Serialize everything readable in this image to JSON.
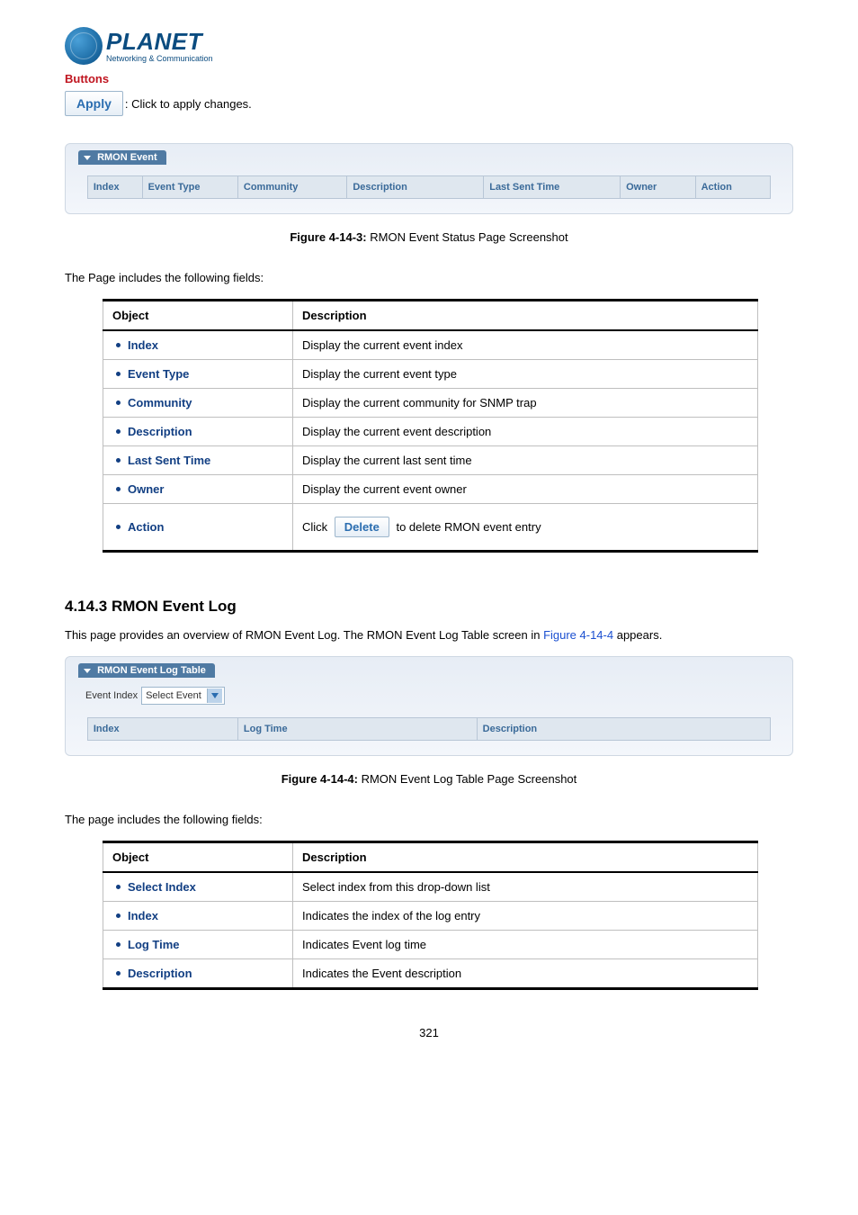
{
  "logo": {
    "main": "PLANET",
    "sub": "Networking & Communication"
  },
  "buttons_section": {
    "heading": "Buttons",
    "apply_label": "Apply",
    "apply_desc": ": Click to apply changes."
  },
  "panel1": {
    "legend": "RMON Event",
    "cols": [
      "Index",
      "Event Type",
      "Community",
      "Description",
      "Last Sent Time",
      "Owner",
      "Action"
    ]
  },
  "figure1": {
    "label": "Figure 4-14-3:",
    "caption": "RMON Event Status Page Screenshot"
  },
  "intro1": "The Page includes the following fields:",
  "objtable1": {
    "headers": {
      "object": "Object",
      "description": "Description"
    },
    "rows": [
      {
        "obj": "Index",
        "desc": "Display the current event index"
      },
      {
        "obj": "Event Type",
        "desc": "Display the current event type"
      },
      {
        "obj": "Community",
        "desc": "Display the current community for SNMP trap"
      },
      {
        "obj": "Description",
        "desc": "Display the current event description"
      },
      {
        "obj": "Last Sent Time",
        "desc": "Display the current last sent time"
      },
      {
        "obj": "Owner",
        "desc": "Display the current event owner"
      }
    ],
    "action_row": {
      "obj": "Action",
      "pre": "Click",
      "button": "Delete",
      "post": "to delete RMON event entry"
    }
  },
  "section2": {
    "heading": "4.14.3 RMON Event Log",
    "intro_pre": "This page provides an overview of RMON Event Log. The RMON Event Log Table screen in ",
    "intro_link": "Figure 4-14-4",
    "intro_post": " appears."
  },
  "panel2": {
    "legend": "RMON Event Log Table",
    "form_label": "Event Index",
    "select_value": "Select Event",
    "cols": [
      "Index",
      "Log Time",
      "Description"
    ]
  },
  "figure2": {
    "label": "Figure 4-14-4:",
    "caption": "RMON Event Log Table Page Screenshot"
  },
  "intro2": "The page includes the following fields:",
  "objtable2": {
    "headers": {
      "object": "Object",
      "description": "Description"
    },
    "rows": [
      {
        "obj": "Select Index",
        "desc": "Select index from this drop-down list"
      },
      {
        "obj": "Index",
        "desc": "Indicates the index of the log entry"
      },
      {
        "obj": "Log Time",
        "desc": "Indicates Event log time"
      },
      {
        "obj": "Description",
        "desc": "Indicates the Event description"
      }
    ]
  },
  "page_number": "321"
}
